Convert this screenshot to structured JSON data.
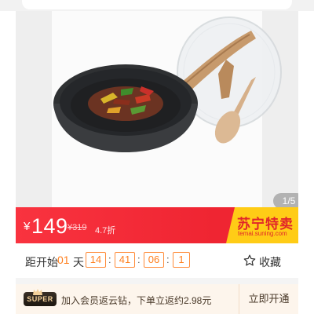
{
  "product": {
    "image_pager": "1/5"
  },
  "price": {
    "currency": "¥",
    "current": "149",
    "original": "¥319",
    "discount": "4.7折"
  },
  "badge": {
    "title": "苏宁特卖",
    "subtitle": "temai.suning.com"
  },
  "countdown": {
    "label": "距开始",
    "days": "01",
    "day_unit": "天",
    "hours": "14",
    "minutes": "41",
    "seconds": "06",
    "tenths": "1",
    "separator": ":"
  },
  "favorite": {
    "label": "收藏",
    "icon": "star-outline-icon"
  },
  "super_member": {
    "badge_label": "SUPER",
    "description": "加入会员返云钻，下单立返约2.98元",
    "button_label": "立即开通"
  },
  "colors": {
    "price_bar": "#f9333f",
    "badge_yellow": "#ffcc16",
    "badge_red": "#e1252a",
    "countdown_orange": "#ff7f1e",
    "super_bg": "#fdf5ec"
  }
}
